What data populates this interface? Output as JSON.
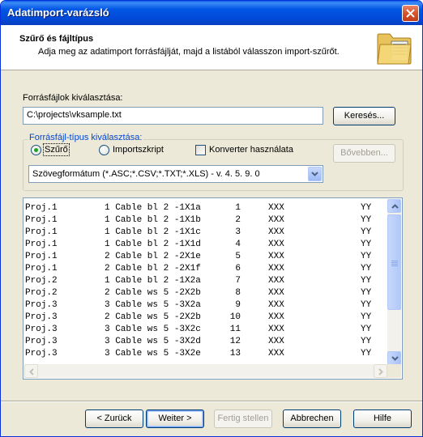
{
  "window": {
    "title": "Adatimport-varázsló"
  },
  "header": {
    "title": "Szűrő és fájltípus",
    "subtitle": "Adja meg az adatimport forrásfájlját, majd a listából válasszon import-szűrőt."
  },
  "source": {
    "label": "Forrásfájlok kiválasztása:",
    "path": "C:\\projects\\vksample.txt",
    "browse_label": "Keresés..."
  },
  "filetype": {
    "group_label": "Forrásfájl-típus kiválasztása:",
    "radio_filter_label": "Szűrő",
    "radio_filter_selected": true,
    "radio_script_label": "Importszkript",
    "converter_label": "Konverter használata",
    "converter_checked": false,
    "more_label": "Bővebben...",
    "filter_selected": "Szövegformátum (*.ASC;*.CSV;*.TXT;*.XLS) - v. 4. 5. 9. 0"
  },
  "preview": {
    "rows": [
      [
        "Proj.1",
        "1 Cable bl 2  -1X1a",
        "1",
        "XXX",
        "YY"
      ],
      [
        "Proj.1",
        "1 Cable bl 2  -1X1b",
        "2",
        "XXX",
        "YY"
      ],
      [
        "Proj.1",
        "1 Cable bl 2  -1X1c",
        "3",
        "XXX",
        "YY"
      ],
      [
        "Proj.1",
        "1 Cable bl 2  -1X1d",
        "4",
        "XXX",
        "YY"
      ],
      [
        "Proj.1",
        "2 Cable bl 2  -2X1e",
        "5",
        "XXX",
        "YY"
      ],
      [
        "Proj.1",
        "2 Cable bl 2  -2X1f",
        "6",
        "XXX",
        "YY"
      ],
      [
        "Proj.2",
        "1 Cable bl 2  -1X2a",
        "7",
        "XXX",
        "YY"
      ],
      [
        "Proj.2",
        "2 Cable ws 5  -2X2b",
        "8",
        "XXX",
        "YY"
      ],
      [
        "Proj.3",
        "3 Cable ws 5  -3X2a",
        "9",
        "XXX",
        "YY"
      ],
      [
        "Proj.3",
        "2 Cable ws 5  -2X2b",
        "10",
        "XXX",
        "YY"
      ],
      [
        "Proj.3",
        "3 Cable ws 5  -3X2c",
        "11",
        "XXX",
        "YY"
      ],
      [
        "Proj.3",
        "3 Cable ws 5  -3X2d",
        "12",
        "XXX",
        "YY"
      ],
      [
        "Proj.3",
        "3 Cable ws 5  -3X2e",
        "13",
        "XXX",
        "YY"
      ]
    ]
  },
  "footer": {
    "back_label": "< Zurück",
    "next_label": "Weiter >",
    "finish_label": "Fertig stellen",
    "cancel_label": "Abbrechen",
    "help_label": "Hilfe"
  },
  "colors": {
    "titlebar": "#0256e5",
    "group_label": "#0046d5",
    "radio_selected": "#21a121"
  }
}
